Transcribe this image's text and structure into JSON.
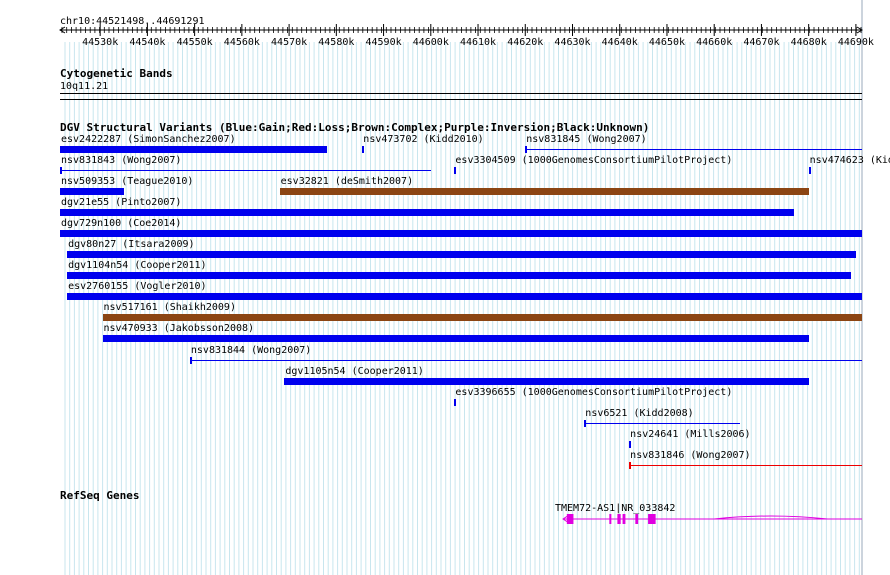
{
  "locus": "chr10:44521498..44691291",
  "ruler": {
    "ticks": [
      "44530k",
      "44540k",
      "44550k",
      "44560k",
      "44570k",
      "44580k",
      "44590k",
      "44600k",
      "44610k",
      "44620k",
      "44630k",
      "44640k",
      "44650k",
      "44660k",
      "44670k",
      "44680k",
      "44690k"
    ],
    "start": 44521498,
    "end": 44691291
  },
  "cytoband": {
    "title": "Cytogenetic Bands",
    "band": "10q11.21"
  },
  "dgv": {
    "title": "DGV Structural Variants (Blue:Gain;Red:Loss;Brown:Complex;Purple:Inversion;Black:Unknown)",
    "colors": {
      "gain": "#0000ee",
      "loss": "#ee0000",
      "complex": "#8b4513",
      "inversion": "#800080",
      "unknown": "#000000"
    },
    "variants": [
      {
        "label": "esv2422287 (SimonSanchez2007)",
        "start": 44521498,
        "end": 44578000,
        "type": "gain"
      },
      {
        "label": "nsv473702 (Kidd2010)",
        "start": 44585500,
        "end": 44585700,
        "type": "gain"
      },
      {
        "label": "nsv831845 (Wong2007)",
        "start": 44620000,
        "end": 44691291,
        "type": "gain"
      },
      {
        "label": "nsv831843 (Wong2007)",
        "start": 44521498,
        "end": 44600000,
        "type": "gain"
      },
      {
        "label": "esv3304509 (1000GenomesConsortiumPilotProject)",
        "start": 44605000,
        "end": 44605200,
        "type": "gain"
      },
      {
        "label": "nsv474623 (Kidd2010)",
        "start": 44680000,
        "end": 44680200,
        "type": "gain"
      },
      {
        "label": "nsv509353 (Teague2010)",
        "start": 44521498,
        "end": 44535000,
        "type": "gain"
      },
      {
        "label": "esv32821 (deSmith2007)",
        "start": 44568000,
        "end": 44680000,
        "type": "complex"
      },
      {
        "label": "dgv21e55 (Pinto2007)",
        "start": 44521498,
        "end": 44677000,
        "type": "gain"
      },
      {
        "label": "dgv729n100 (Coe2014)",
        "start": 44521498,
        "end": 44691291,
        "type": "gain"
      },
      {
        "label": "dgv80n27 (Itsara2009)",
        "start": 44523000,
        "end": 44690000,
        "type": "gain"
      },
      {
        "label": "dgv1104n54 (Cooper2011)",
        "start": 44523000,
        "end": 44689000,
        "type": "gain"
      },
      {
        "label": "esv2760155 (Vogler2010)",
        "start": 44523000,
        "end": 44691291,
        "type": "gain"
      },
      {
        "label": "nsv517161 (Shaikh2009)",
        "start": 44530500,
        "end": 44691291,
        "type": "complex"
      },
      {
        "label": "nsv470933 (Jakobsson2008)",
        "start": 44530500,
        "end": 44680000,
        "type": "gain"
      },
      {
        "label": "nsv831844 (Wong2007)",
        "start": 44549000,
        "end": 44691291,
        "type": "gain"
      },
      {
        "label": "dgv1105n54 (Cooper2011)",
        "start": 44569000,
        "end": 44680000,
        "type": "gain"
      },
      {
        "label": "esv3396655 (1000GenomesConsortiumPilotProject)",
        "start": 44605000,
        "end": 44605200,
        "type": "gain"
      },
      {
        "label": "nsv6521 (Kidd2008)",
        "start": 44632500,
        "end": 44665500,
        "type": "gain"
      },
      {
        "label": "nsv24641 (Mills2006)",
        "start": 44642000,
        "end": 44642200,
        "type": "gain"
      },
      {
        "label": "nsv831846 (Wong2007)",
        "start": 44642000,
        "end": 44691291,
        "type": "loss"
      }
    ]
  },
  "refseq": {
    "title": "RefSeq Genes",
    "color": "#e000e0",
    "gene": {
      "label": "TMEM72-AS1|NR_033842",
      "start": 44628000,
      "end": 44691291,
      "exons": [
        [
          44628800,
          44630200
        ],
        [
          44637800,
          44638200
        ],
        [
          44639500,
          44640200
        ],
        [
          44640600,
          44641200
        ],
        [
          44643300,
          44643900
        ],
        [
          44646000,
          44647600
        ]
      ]
    }
  }
}
